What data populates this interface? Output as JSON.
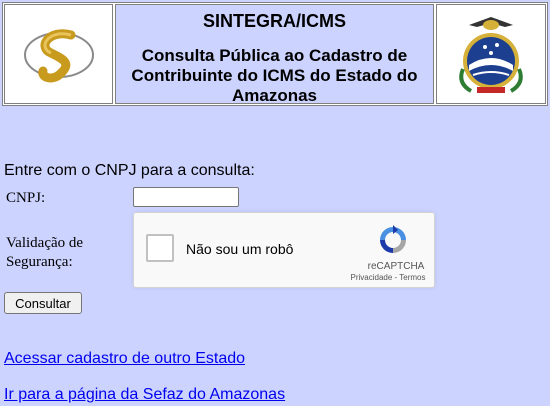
{
  "header": {
    "title": "SINTEGRA/ICMS",
    "subtitle": "Consulta Pública ao Cadastro de Contribuinte do ICMS do Estado do Amazonas"
  },
  "form": {
    "prompt": "Entre com o CNPJ para a consulta:",
    "cnpj_label": "CNPJ:",
    "cnpj_value": "",
    "validation_label": "Validação de Segurança:",
    "submit_label": "Consultar"
  },
  "captcha": {
    "checkbox_label": "Não sou um robô",
    "brand": "reCAPTCHA",
    "links": "Privacidade - Termos"
  },
  "links": {
    "other_state": "Acessar cadastro de outro Estado",
    "sefaz": "Ir para a página da Sefaz do Amazonas"
  },
  "colors": {
    "background": "#ccd3ff",
    "link": "#0000ee"
  }
}
